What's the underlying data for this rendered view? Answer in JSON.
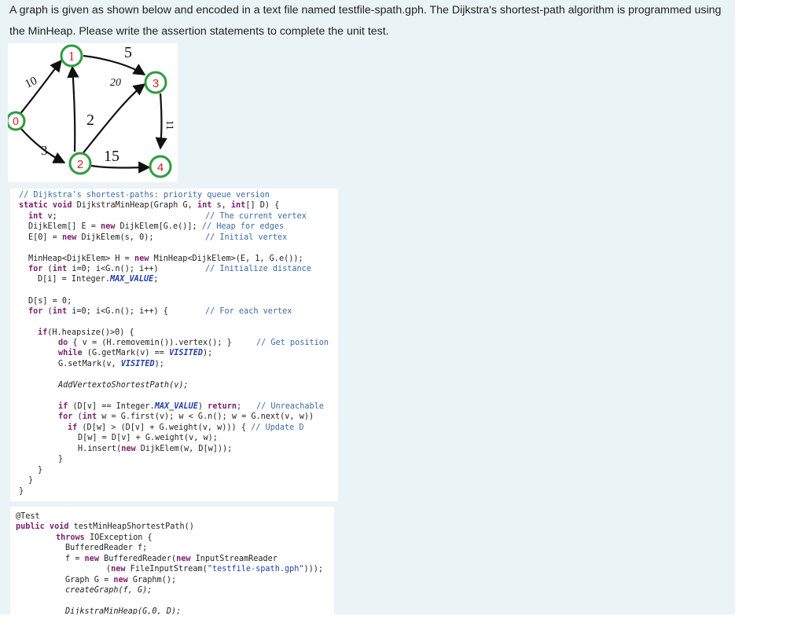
{
  "question": {
    "line1": "A graph is given as shown below and encoded in a text file named testfile-spath.gph. The Dijkstra's shortest-path algorithm is programmed using",
    "line2": "the MinHeap. Please write the assertion statements to complete the unit test."
  },
  "graph": {
    "nodes": [
      {
        "id": "n0",
        "label": "0"
      },
      {
        "id": "n1",
        "label": "1"
      },
      {
        "id": "n2",
        "label": "2"
      },
      {
        "id": "n3",
        "label": "3"
      },
      {
        "id": "n4",
        "label": "4"
      }
    ],
    "edge_labels": {
      "e01": "10",
      "e13": "5",
      "e23": "20",
      "e21": "2",
      "e02": "3",
      "e24": "15",
      "e34": "11"
    },
    "colors": {
      "node_stroke": "#2e9c3e",
      "node_fill_0": "#ffffff",
      "node_text_0": "#d32222",
      "node_text": "#d32222",
      "edge": "#111111"
    }
  },
  "code1": {
    "l1": "// Dijkstra's shortest-paths: priority queue version",
    "l2a": "static void ",
    "l2b": "DijkstraMinHeap(Graph G, ",
    "l2c": "int",
    " l2d": " s, ",
    "l2e": "int",
    "l2f": "[] D) {",
    "l3a": "int",
    " l3b": " v;",
    "l3c": "// The current vertex",
    "l4a": "DijkElem[] E = ",
    "l4b": "new",
    " l4c": " DijkElem[G.e()]; ",
    "l4d": "// Heap for edges",
    "l5a": "E[0] = ",
    "l5b": "new",
    " l5c": " DijkElem(s, 0);",
    "l5d": "// Initial vertex",
    "l6a": "MinHeap<DijkElem> H = ",
    "l6b": "new",
    " l6c": " MinHeap<DijkElem>(E, 1, G.e());",
    "l7a": "for",
    " l7b": " (",
    "l7c": "int",
    " l7d": " i=0; i<G.n(); i++)",
    "l7e": "// Initialize distance",
    "l8a": "D[i] = Integer.",
    "l8b": "MAX_VALUE",
    ";": ";",
    "l9": "D[s] = 0;",
    "l10a": "for",
    " l10b": " (",
    "l10c": "int",
    " l10d": " i=0; i<G.n(); i++) {",
    "l10e": "// For each vertex",
    "l11a": "if",
    "l11b": "(H.heapsize()>0) {",
    "l12a": "do",
    " l12b": " { v = (H.removemin()).vertex(); }",
    "l12c": "// Get position",
    "l13a": "while",
    " l13b": " (G.getMark(v) == ",
    "l13c": "VISITED",
    "l13d": ");",
    "l14a": "G.setMark(v, ",
    "l14b": "VISITED",
    "l14c": ");",
    "l15": "AddVertextoShortestPath(v);",
    "l16a": "if",
    " l16b": " (D[v] == Integer.",
    "l16c": "MAX_VALUE",
    "l16d": ") ",
    "l16e": "return",
    "l16f": "// Unreachable",
    "l17a": "for",
    " l17b": " (",
    "l17c": "int",
    " l17d": " w = G.first(v); w < G.n(); w = G.next(v, w))",
    "l18a": "if",
    " l18b": " (D[w] > (D[v] + G.weight(v, w))) { ",
    "l18c": "// Update D",
    "l19": "D[w] = D[v] + G.weight(v, w);",
    "l20a": "H.insert(",
    "l20b": "new",
    " l20c": " DijkElem(w, D[w]));",
    "l21": "}",
    "l22": "}",
    "l23": "}",
    "l24": "}"
  },
  "code2": {
    "l1": "@Test",
    "l2a": "public void ",
    "l2b": "testMinHeapShortestPath()",
    "l3a": "throws",
    " l3b": " IOException {",
    "l4": "BufferedReader f;",
    "l5a": "f = ",
    "l5b": "new",
    " l5c": " BufferedReader(",
    "l5d": "new",
    " l5e": " InputStreamReader",
    "l6a": "(",
    "l6b": "new",
    " l6c": " FileInputStream(",
    "l6d": "\"testfile-spath.gph\"",
    "l6e": "))); ",
    "l7a": "Graph G = ",
    "l7b": "new",
    " l7c": " Graphm();",
    "l8": "createGraph(f, G);",
    "l9": "DijkstraMinHeap(G,0, D);"
  }
}
